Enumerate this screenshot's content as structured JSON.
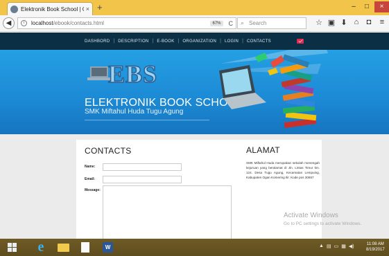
{
  "browser": {
    "tab_title": "Elektronik Book School | Co",
    "tab_close": "×",
    "new_tab": "+",
    "url_host": "localhost",
    "url_path": "/ebook/contacts.html",
    "zoom": "67%",
    "reload": "C",
    "search_placeholder": "Search",
    "window_minimize": "–",
    "window_maximize": "□",
    "window_close": "×",
    "icons": [
      "info-icon",
      "bookmark-star-icon",
      "reader-icon",
      "download-icon",
      "home-icon",
      "pocket-icon",
      "menu-icon"
    ]
  },
  "site": {
    "nav": [
      "DASHBORD",
      "DESCRIPTION",
      "E-BOOK",
      "ORGANIZATION",
      "LOGIN",
      "CONTACTS"
    ],
    "logo_text": "EBS",
    "title": "ELEKTRONIK BOOK SCHOOL",
    "subtitle": "SMK Miftahul Huda Tugu Agung",
    "colors": {
      "nav_bg": "#0b2f45",
      "banner": "#1e8fd8",
      "mail": "#e02a4f"
    }
  },
  "contacts": {
    "heading": "CONTACTS",
    "name_label": "Name:",
    "email_label": "Email:",
    "message_label": "Message:",
    "name_value": "",
    "email_value": "",
    "message_value": ""
  },
  "alamat": {
    "heading": "ALAMAT",
    "text": "SMK Miftahul Huda merupakan sekolah menengah kejuruan yang beralamat di Jln. Lintas Timur km. 124. Desa Tugu Agung, Kecamatan Lempuing, Kabupaten Ogan Komering Ilir. Kode pos 30657"
  },
  "watermark": {
    "title": "Activate Windows",
    "subtitle": "Go to PC settings to activate Windows."
  },
  "taskbar": {
    "word_label": "W",
    "time": "11:08 AM",
    "date": "8/19/2017"
  }
}
